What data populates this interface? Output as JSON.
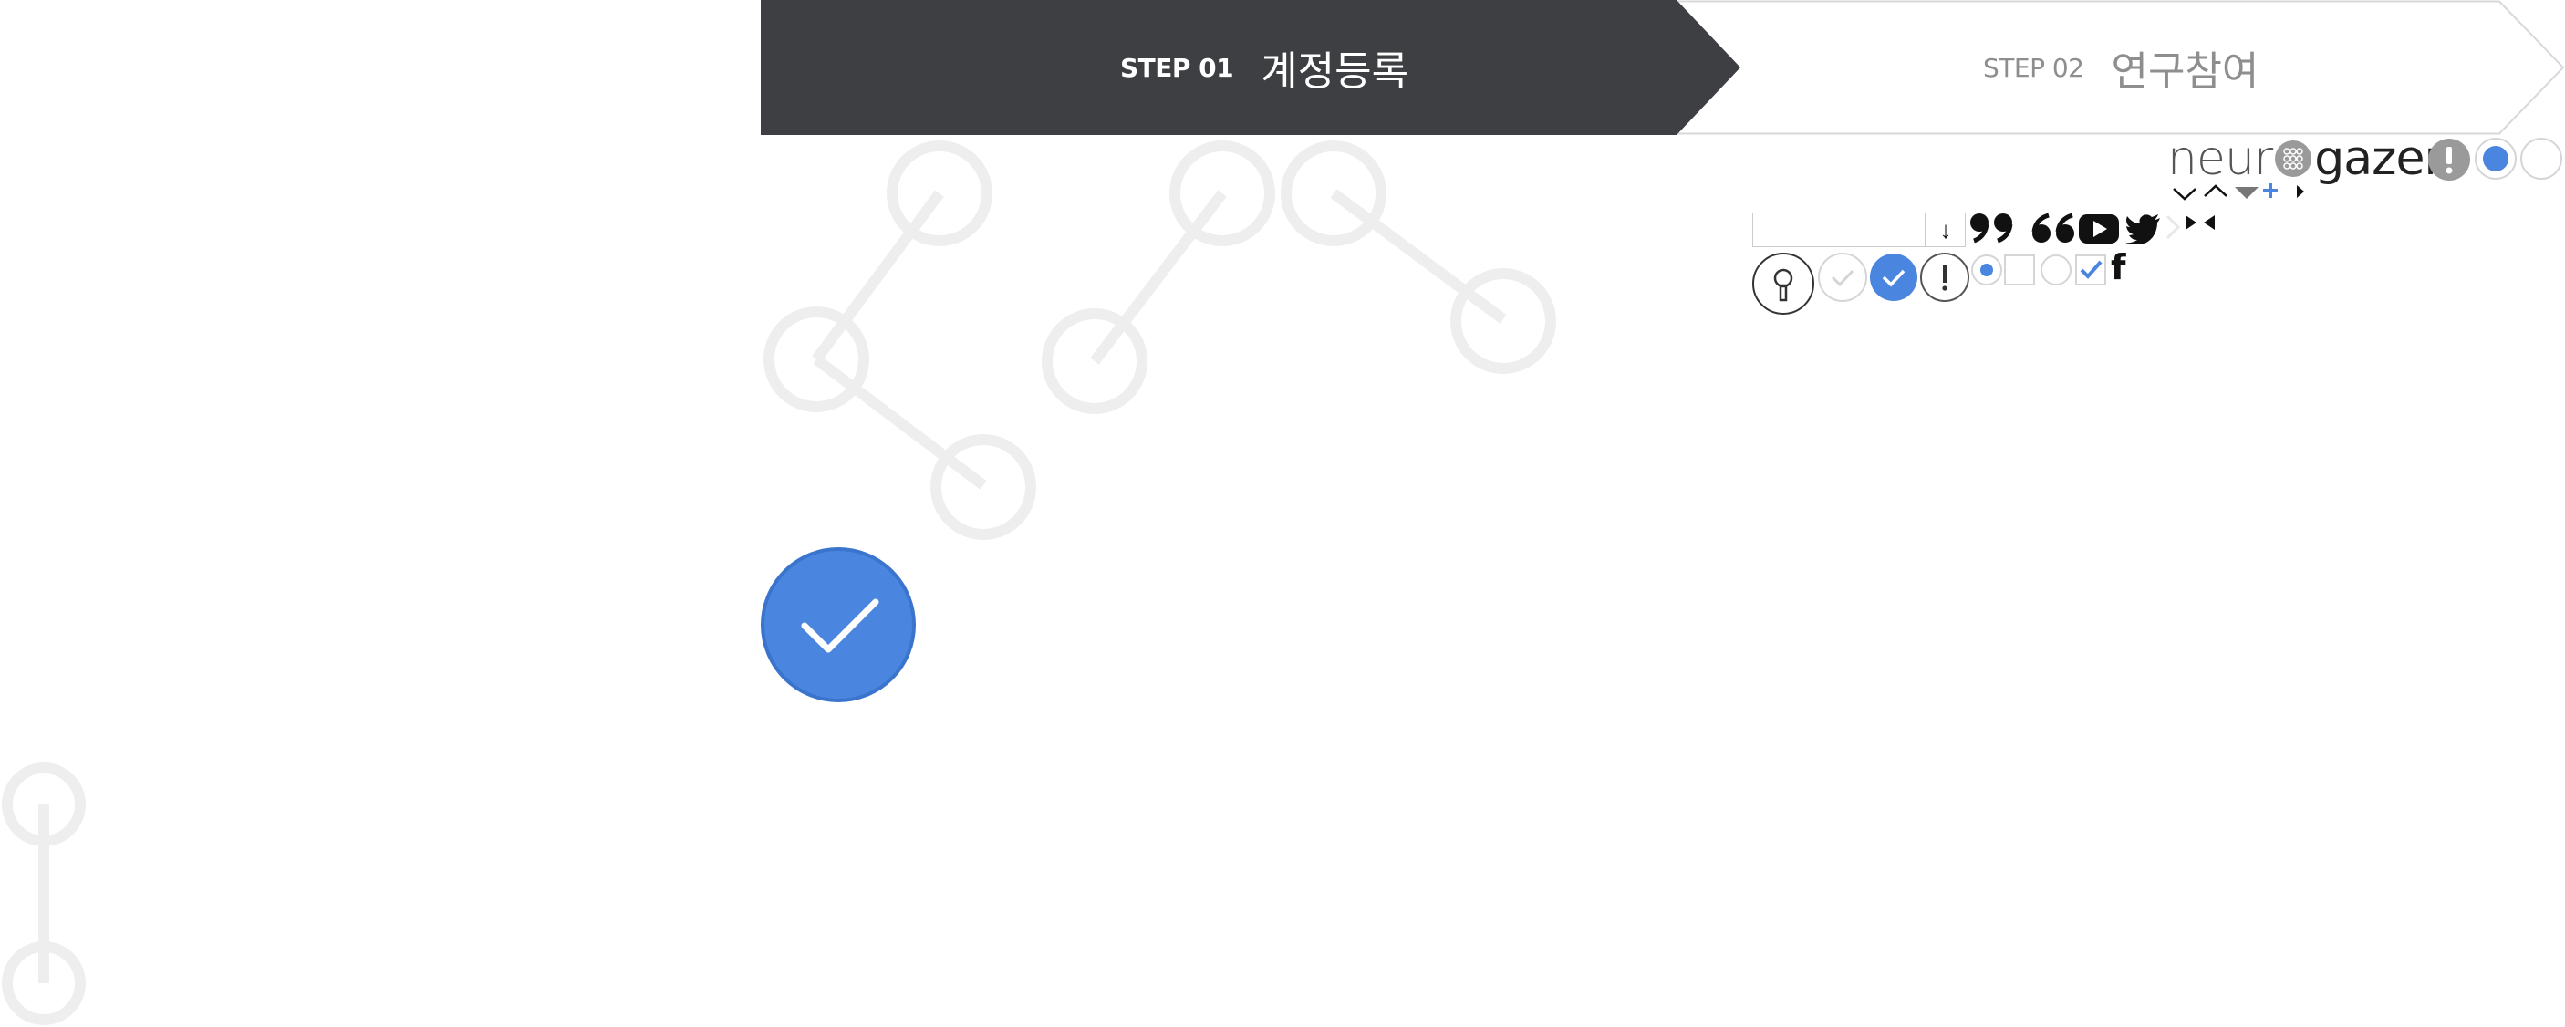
{
  "steps": [
    {
      "number": "STEP 01",
      "title": "계정등록",
      "state": "active"
    },
    {
      "number": "STEP 02",
      "title": "연구참여",
      "state": "inactive"
    }
  ],
  "logo": {
    "text_left": "neur",
    "text_right": "gazer"
  },
  "colors": {
    "step_active_bg": "#3e3f43",
    "step_inactive_text": "#8e8e8e",
    "accent_blue": "#4a86e0",
    "decor_gray": "#eeeeee",
    "warning_gray": "#9a9a9a"
  },
  "sprites": {
    "download_arrow": "↓",
    "facebook_glyph": "f",
    "exclamation": "!"
  },
  "icons": [
    "key-icon",
    "check-outline-icon",
    "check-filled-icon",
    "alert-icon",
    "radio-selected-icon",
    "checkbox-empty-icon",
    "radio-empty-icon",
    "checkbox-checked-icon",
    "facebook-icon",
    "quote-open-icon",
    "quote-close-icon",
    "youtube-icon",
    "twitter-icon",
    "chevron-right-icon",
    "collapse-icon",
    "chevron-down-icon",
    "chevron-up-icon",
    "caret-down-icon",
    "plus-icon",
    "caret-right-icon",
    "warning-circle-icon",
    "radio-blue-icon",
    "radio-white-icon"
  ]
}
